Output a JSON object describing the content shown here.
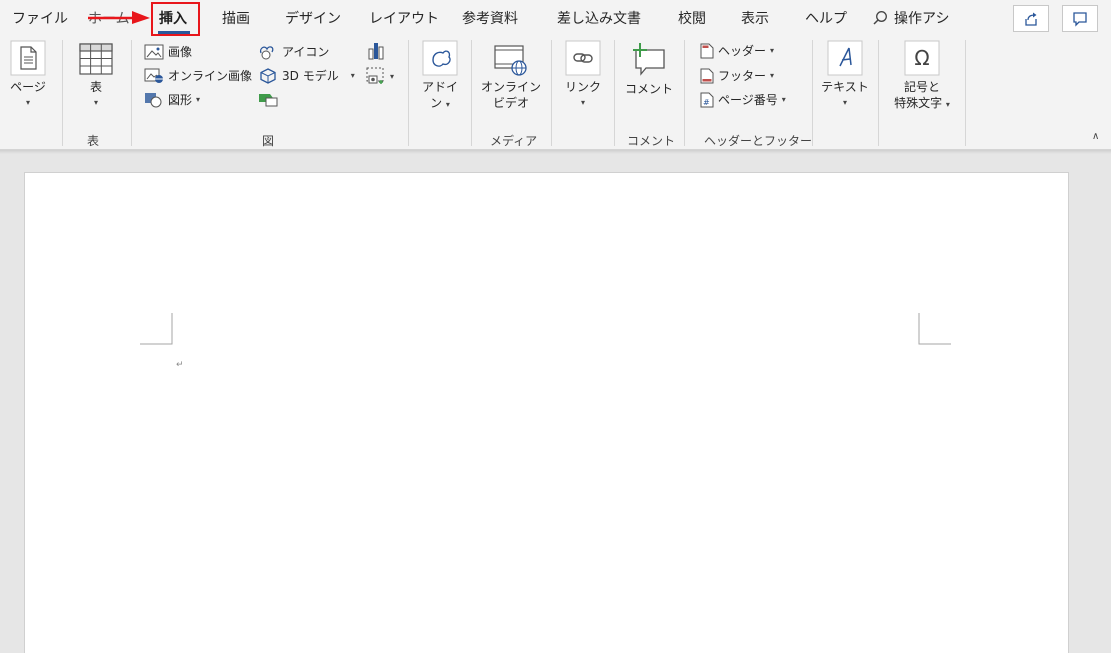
{
  "tabs": [
    "ファイル",
    "ホーム",
    "挿入",
    "描画",
    "デザイン",
    "レイアウト",
    "参考資料",
    "差し込み文書",
    "校閲",
    "表示",
    "ヘルプ"
  ],
  "search_label": "操作アシ",
  "groups": {
    "pages": {
      "button": "ページ"
    },
    "table": {
      "button": "表",
      "label": "表"
    },
    "illustrations": {
      "label": "図",
      "picture": "画像",
      "online_picture": "オンライン画像",
      "shapes": "図形",
      "icons": "アイコン",
      "models_3d": "3D モデル"
    },
    "addins": {
      "button_line1": "アドイ",
      "button_line2": "ン"
    },
    "media": {
      "label": "メディア",
      "button_line1": "オンライン",
      "button_line2": "ビデオ"
    },
    "links": {
      "button": "リンク"
    },
    "comments": {
      "label": "コメント",
      "button": "コメント"
    },
    "header_footer": {
      "label": "ヘッダーとフッター",
      "header": "ヘッダー",
      "footer": "フッター",
      "page_number": "ページ番号"
    },
    "text": {
      "button": "テキスト"
    },
    "symbols": {
      "button_line1": "記号と",
      "button_line2": "特殊文字"
    }
  },
  "document": {
    "paragraph_mark": "↵"
  },
  "colors": {
    "accent": "#2b579a",
    "highlight": "#e8161b",
    "comment_plus": "#3f9b4a"
  }
}
